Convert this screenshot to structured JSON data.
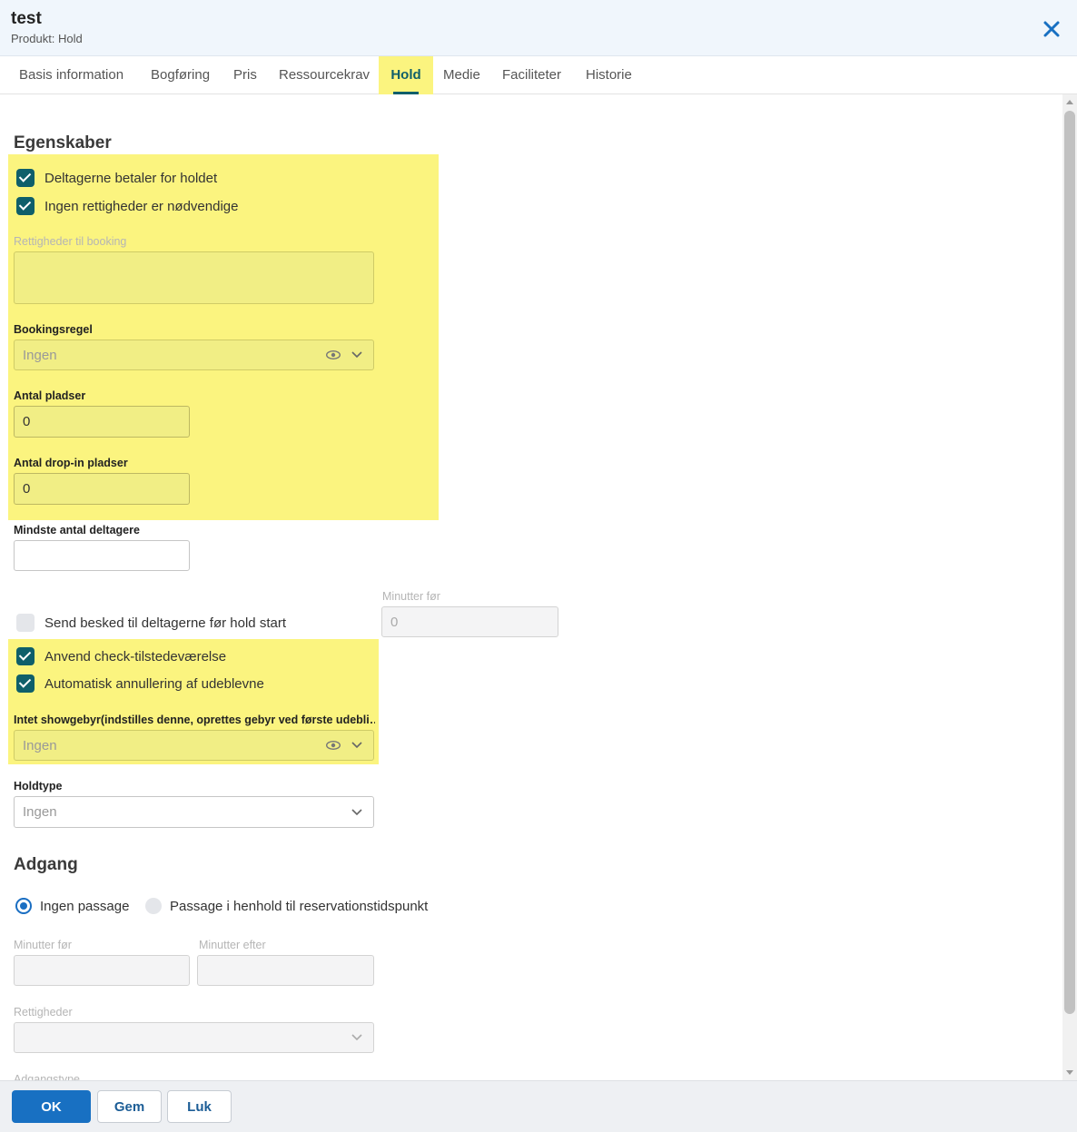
{
  "header": {
    "title": "test",
    "subtitle": "Produkt: Hold"
  },
  "tabs": [
    {
      "label": "Basis information"
    },
    {
      "label": "Bogføring"
    },
    {
      "label": "Pris"
    },
    {
      "label": "Ressourcekrav"
    },
    {
      "label": "Hold",
      "active": true
    },
    {
      "label": "Medie"
    },
    {
      "label": "Faciliteter"
    },
    {
      "label": "Historie"
    }
  ],
  "egenskaber": {
    "heading": "Egenskaber",
    "cb_pay": {
      "label": "Deltagerne betaler for holdet",
      "checked": true
    },
    "cb_no_rights": {
      "label": "Ingen rettigheder er nødvendige",
      "checked": true
    },
    "rights_booking": {
      "label": "Rettigheder til booking",
      "value": ""
    },
    "booking_rule": {
      "label": "Bookingsregel",
      "value": "Ingen"
    },
    "seats": {
      "label": "Antal pladser",
      "value": "0"
    },
    "dropin": {
      "label": "Antal drop-in pladser",
      "value": "0"
    },
    "min_participants": {
      "label": "Mindste antal deltagere",
      "value": ""
    },
    "send_msg": {
      "label": "Send besked til deltagerne før hold start",
      "checked": false
    },
    "minutes_before": {
      "label": "Minutter før",
      "value": "0"
    },
    "cb_checkin": {
      "label": "Anvend check-tilstedeværelse",
      "checked": true
    },
    "cb_autocancel": {
      "label": "Automatisk annullering af udeblevne",
      "checked": true
    },
    "noshow_fee": {
      "label": "Intet showgebyr(indstilles denne, oprettes gebyr ved første udebli…",
      "value": "Ingen"
    },
    "holdtype": {
      "label": "Holdtype",
      "value": "Ingen"
    }
  },
  "adgang": {
    "heading": "Adgang",
    "radio_none": {
      "label": "Ingen passage",
      "selected": true
    },
    "radio_reservation": {
      "label": "Passage i henhold til reservationstidspunkt",
      "selected": false
    },
    "minutes_before": {
      "label": "Minutter før",
      "value": ""
    },
    "minutes_after": {
      "label": "Minutter efter",
      "value": ""
    },
    "rights": {
      "label": "Rettigheder",
      "value": ""
    },
    "access_type": {
      "label": "Adgangstype"
    }
  },
  "footer": {
    "ok": "OK",
    "save": "Gem",
    "close": "Luk"
  },
  "colors": {
    "highlight": "#fbf47f",
    "teal": "#0f5f6a",
    "primary": "#1870c2"
  },
  "icons": [
    "close-icon",
    "eye-icon",
    "chevron-down-icon",
    "check-icon"
  ]
}
